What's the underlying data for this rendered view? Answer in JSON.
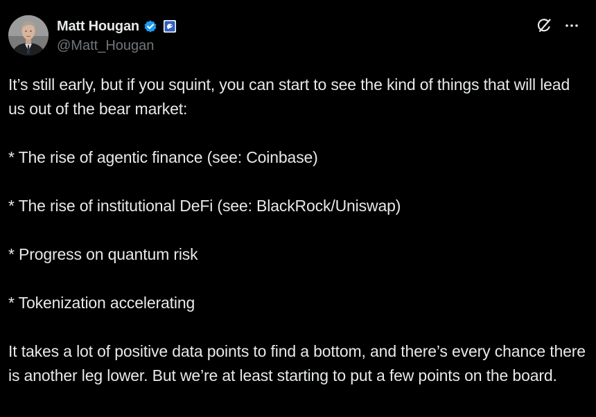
{
  "author": {
    "display_name": "Matt Hougan",
    "handle": "@Matt_Hougan",
    "verified_badge_color": "#1d9bf0",
    "affiliate_badge_color": "#2f5fbf"
  },
  "icons": {
    "verified": "verified-badge-icon",
    "affiliate": "affiliate-badge-icon",
    "grok": "grok-icon",
    "more": "more-options-icon"
  },
  "tweet": {
    "paragraphs": [
      "It’s still early, but if you squint, you can start to see the kind of things that will lead us out of the bear market:",
      "* The rise of agentic finance (see: Coinbase)",
      "* The rise of institutional DeFi (see: BlackRock/Uniswap)",
      "* Progress on quantum risk",
      "* Tokenization accelerating",
      "It takes a lot of positive data points to find a bottom, and there’s every chance there is another leg lower. But we’re at least starting to put a few points on the board."
    ]
  },
  "colors": {
    "background": "#000000",
    "text_primary": "#e7e9ea",
    "text_secondary": "#71767b"
  }
}
